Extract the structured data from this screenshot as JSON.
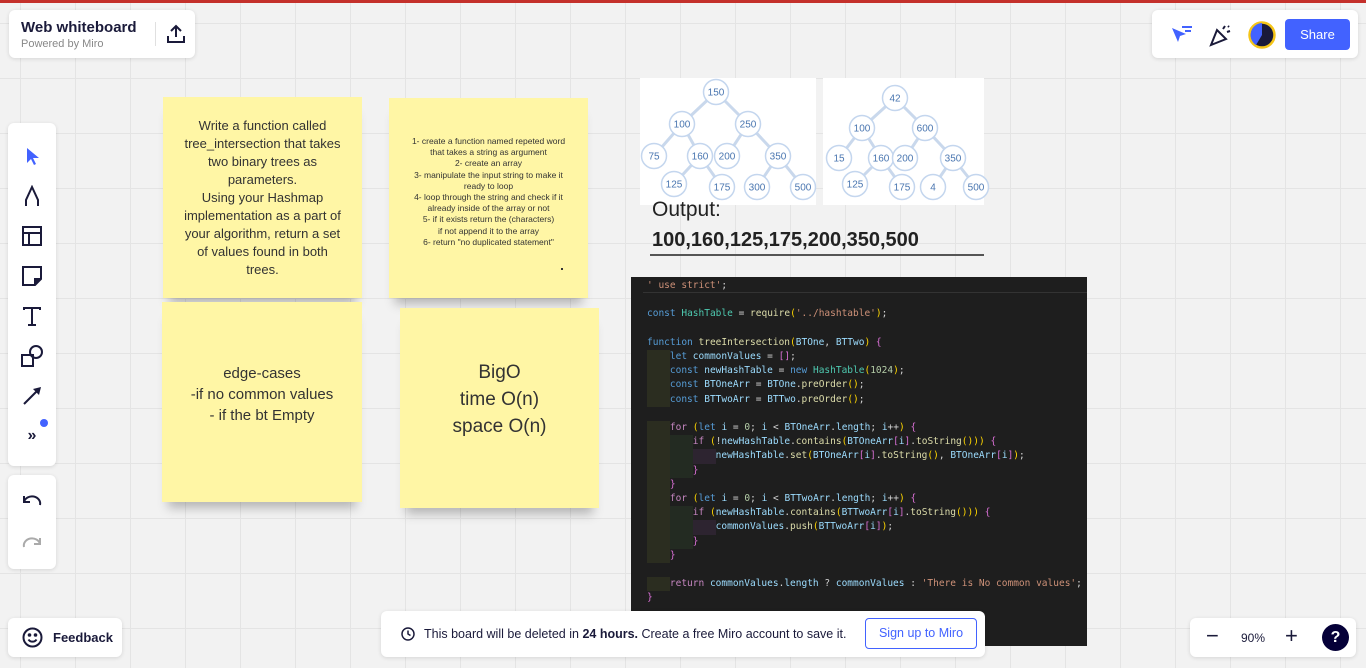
{
  "header": {
    "title": "Web whiteboard",
    "subtitle": "Powered by Miro",
    "share_label": "Share"
  },
  "toolbar": {
    "tools": [
      "select-icon",
      "pen-icon",
      "frame-icon",
      "sticky-note-icon",
      "text-icon",
      "shapes-icon",
      "arrow-icon",
      "more-tools-icon"
    ],
    "undo": "undo-icon",
    "redo": "redo-icon"
  },
  "stickies": [
    {
      "text": "Write a function called tree_intersection that takes two binary trees as parameters.\nUsing your Hashmap implementation as a part of your algorithm, return a set of values found in both trees."
    },
    {
      "text": "1- create a function named repeted word\nthat takes a string as argument\n2- create an array\n3- manipulate the input string to make it\nready to loop\n4- loop through the string and check if it\nalready inside of the array or not\n5- if it exists return the (characters)\nif not append it to the array\n6- return \"no duplicated statement\""
    },
    {
      "text": "edge-cases\n-if no common values\n- if the bt Empty"
    },
    {
      "text": "BigO\ntime O(n)\nspace O(n)"
    }
  ],
  "trees": [
    {
      "nodes": [
        "150",
        "100",
        "250",
        "75",
        "160",
        "200",
        "350",
        "125",
        "175",
        "300",
        "500"
      ]
    },
    {
      "nodes": [
        "42",
        "100",
        "600",
        "15",
        "160",
        "200",
        "350",
        "125",
        "175",
        "4",
        "500"
      ]
    }
  ],
  "output": {
    "label": "Output:",
    "values": "100,160,125,175,200,350,500"
  },
  "code": {
    "lines": [
      "' use strict';",
      "",
      "const HashTable = require('../hashtable');",
      "",
      "function treeIntersection(BTOne, BTTwo) {",
      "    let commonValues = [];",
      "    const newHashTable = new HashTable(1024);",
      "    const BTOneArr = BTOne.preOrder();",
      "    const BTTwoArr = BTTwo.preOrder();",
      "",
      "    for (let i = 0; i < BTOneArr.length; i++) {",
      "        if (!newHashTable.contains(BTOneArr[i].toString())) {",
      "            newHashTable.set(BTOneArr[i].toString(), BTOneArr[i]);",
      "        }",
      "    }",
      "    for (let i = 0; i < BTTwoArr.length; i++) {",
      "        if (newHashTable.contains(BTTwoArr[i].toString())) {",
      "            commonValues.push(BTTwoArr[i]);",
      "        }",
      "    }",
      "",
      "    return commonValues.length ? commonValues : 'There is No common values';",
      "}"
    ]
  },
  "banner": {
    "text_pre": "This board will be deleted in ",
    "text_bold": "24 hours.",
    "text_post": " Create a free Miro account to save it.",
    "signup_label": "Sign up to Miro"
  },
  "feedback": {
    "label": "Feedback"
  },
  "zoom": {
    "level": "90%"
  },
  "colors": {
    "accent": "#4262ff",
    "sticky": "#fff6a5",
    "code_bg": "#1e1e1e"
  }
}
